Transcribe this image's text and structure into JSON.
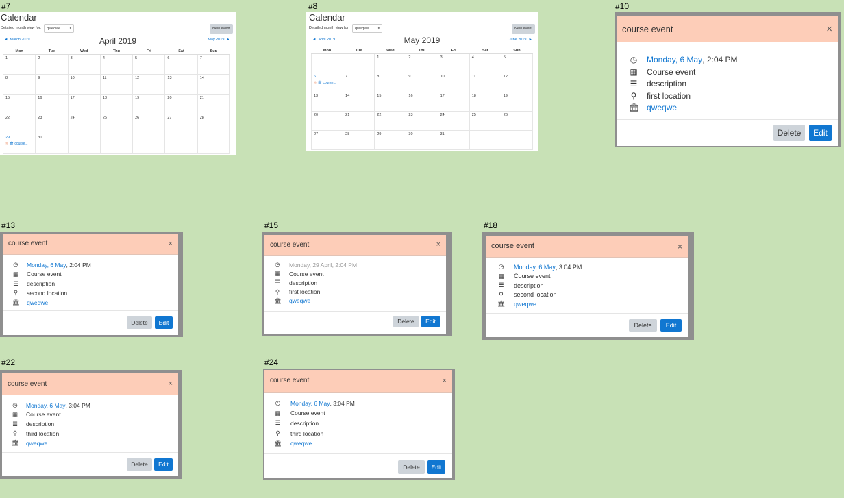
{
  "labels": {
    "s7": "#7",
    "s8": "#8",
    "s10": "#10",
    "s13": "#13",
    "s15": "#15",
    "s18": "#18",
    "s22": "#22",
    "s24": "#24"
  },
  "calendar": {
    "title": "Calendar",
    "view_label": "Detailed month view for:",
    "course_select": "qweqwe",
    "new_event": "New event",
    "weekdays": [
      "Mon",
      "Tue",
      "Wed",
      "Thu",
      "Fri",
      "Sat",
      "Sun"
    ],
    "event_text": "course...",
    "april": {
      "month": "April 2019",
      "prev": "March 2019",
      "next": "May 2019",
      "prev_arrow": "◄",
      "next_arrow": "►",
      "weeks": [
        [
          "1",
          "2",
          "3",
          "4",
          "5",
          "6",
          "7"
        ],
        [
          "8",
          "9",
          "10",
          "11",
          "12",
          "13",
          "14"
        ],
        [
          "15",
          "16",
          "17",
          "18",
          "19",
          "20",
          "21"
        ],
        [
          "22",
          "23",
          "24",
          "25",
          "26",
          "27",
          "28"
        ],
        [
          "29",
          "30",
          "",
          "",
          "",
          "",
          ""
        ]
      ]
    },
    "may": {
      "month": "May 2019",
      "prev": "April 2019",
      "next": "June 2019",
      "prev_arrow": "◄",
      "next_arrow": "►",
      "weeks": [
        [
          "",
          "",
          "1",
          "2",
          "3",
          "4",
          "5"
        ],
        [
          "6",
          "7",
          "8",
          "9",
          "10",
          "11",
          "12"
        ],
        [
          "13",
          "14",
          "15",
          "16",
          "17",
          "18",
          "19"
        ],
        [
          "20",
          "21",
          "22",
          "23",
          "24",
          "25",
          "26"
        ],
        [
          "27",
          "28",
          "29",
          "30",
          "31",
          "",
          ""
        ]
      ]
    }
  },
  "modal": {
    "title": "course event",
    "close": "×",
    "type": "Course event",
    "description": "description",
    "course": "qweqwe",
    "delete": "Delete",
    "edit": "Edit"
  },
  "events": {
    "m10": {
      "date": "Monday, 6 May",
      "time": ", 2:04 PM",
      "location": "first location"
    },
    "m13": {
      "date": "Monday, 6 May",
      "time": ", 2:04 PM",
      "location": "second location"
    },
    "m15": {
      "date": "Monday, 29 April, 2:04 PM",
      "time": "",
      "location": "first location"
    },
    "m18": {
      "date": "Monday, 6 May",
      "time": ", 3:04 PM",
      "location": "second location"
    },
    "m22": {
      "date": "Monday, 6 May",
      "time": ", 3:04 PM",
      "location": "third location"
    },
    "m24": {
      "date": "Monday, 6 May",
      "time": ", 3:04 PM",
      "location": "third location"
    }
  },
  "icons": {
    "clock": "clock-icon",
    "calendar": "calendar-icon",
    "description": "description-icon",
    "location": "map-pin-icon",
    "course": "institution-icon"
  },
  "colors": {
    "background": "#c8e1b6",
    "modal_header": "#fdcdb8",
    "link": "#1177d1",
    "edit_button": "#1177d1",
    "delete_button": "#ced4da",
    "event_dot": "#f0a88a"
  }
}
